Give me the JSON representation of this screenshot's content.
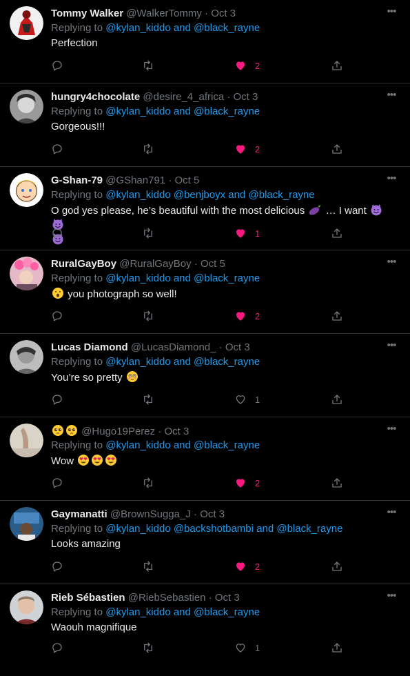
{
  "colors": {
    "background": "#000000",
    "link": "#1d9bf0",
    "muted": "#71767b",
    "like": "#f91880",
    "divider": "#2f3336"
  },
  "tweets": [
    {
      "name": "Tommy Walker",
      "handle": "@WalkerTommy",
      "sep": "·",
      "time": "Oct 3",
      "replying": "Replying to",
      "mentions": [
        "@kylan_kiddo",
        "@black_rayne"
      ],
      "joiner": "and",
      "text": "Perfection",
      "likes": "2",
      "liked": true
    },
    {
      "name": "hungry4chocolate",
      "handle": "@desire_4_africa",
      "sep": "·",
      "time": "Oct 3",
      "replying": "Replying to",
      "mentions": [
        "@kylan_kiddo",
        "@black_rayne"
      ],
      "joiner": "and",
      "text": "Gorgeous!!!",
      "likes": "2",
      "liked": true
    },
    {
      "name": "G-Shan-79",
      "handle": "@GShan791",
      "sep": "·",
      "time": "Oct 5",
      "replying": "Replying to",
      "mentions": [
        "@kylan_kiddo",
        "@benjboyx",
        "@black_rayne"
      ],
      "joiner": "and",
      "text_a": "O god yes please, he’s beautiful with the most delicious",
      "text_b": "… I want",
      "likes": "1",
      "liked": true,
      "emoji": [
        "eggplant",
        "smiling-devil",
        "smiling-devil",
        "smiling-devil"
      ]
    },
    {
      "name": "RuralGayBoy",
      "handle": "@RuralGayBoy",
      "sep": "·",
      "time": "Oct 5",
      "replying": "Replying to",
      "mentions": [
        "@kylan_kiddo",
        "@black_rayne"
      ],
      "joiner": "and",
      "text": "you photograph so well!",
      "likes": "2",
      "liked": true,
      "emoji": [
        "astonished-face"
      ]
    },
    {
      "name": "Lucas Diamond",
      "handle": "@LucasDiamond_",
      "sep": "·",
      "time": "Oct 3",
      "replying": "Replying to",
      "mentions": [
        "@kylan_kiddo",
        "@black_rayne"
      ],
      "joiner": "and",
      "text": "You’re so pretty",
      "likes": "1",
      "liked": false,
      "emoji": [
        "flushed-face"
      ]
    },
    {
      "name": "",
      "handle": "@Hugo19Perez",
      "sep": "·",
      "time": "Oct 3",
      "replying": "Replying to",
      "mentions": [
        "@kylan_kiddo",
        "@black_rayne"
      ],
      "joiner": "and",
      "text": "Wow",
      "likes": "2",
      "liked": true,
      "emoji": [
        "pleading-face",
        "pleading-face",
        "heart-eyes",
        "heart-eyes",
        "heart-eyes"
      ]
    },
    {
      "name": "Gaymanatti",
      "handle": "@BrownSugga_J",
      "sep": "·",
      "time": "Oct 3",
      "replying": "Replying to",
      "mentions": [
        "@kylan_kiddo",
        "@backshotbambi",
        "@black_rayne"
      ],
      "joiner": "and",
      "text": "Looks amazing",
      "likes": "2",
      "liked": true
    },
    {
      "name": "Rieb Sébastien",
      "handle": "@RiebSebastien",
      "sep": "·",
      "time": "Oct 3",
      "replying": "Replying to",
      "mentions": [
        "@kylan_kiddo",
        "@black_rayne"
      ],
      "joiner": "and",
      "text": "Waouh magnifique",
      "likes": "1",
      "liked": false
    }
  ]
}
